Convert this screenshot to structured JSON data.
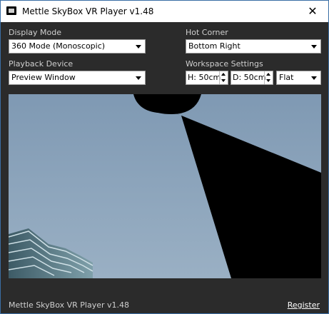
{
  "window": {
    "title": "Mettle SkyBox VR Player v1.48"
  },
  "display_mode": {
    "label": "Display Mode",
    "value": "360 Mode (Monoscopic)"
  },
  "hot_corner": {
    "label": "Hot Corner",
    "value": "Bottom Right"
  },
  "playback_device": {
    "label": "Playback Device",
    "value": "Preview Window"
  },
  "workspace_settings": {
    "label": "Workspace Settings",
    "height_value": "H: 50cm",
    "depth_value": "D: 50cm",
    "shape_value": "Flat"
  },
  "footer": {
    "version_text": "Mettle SkyBox VR Player v1.48",
    "register_label": "Register"
  },
  "colors": {
    "window_bg": "#2b2b2b",
    "sky": "#8fa6bd",
    "accent_border": "#3a6ea5"
  },
  "icons": {
    "close": "close-icon",
    "app": "app-icon",
    "dropdown": "chevron-down-icon"
  }
}
